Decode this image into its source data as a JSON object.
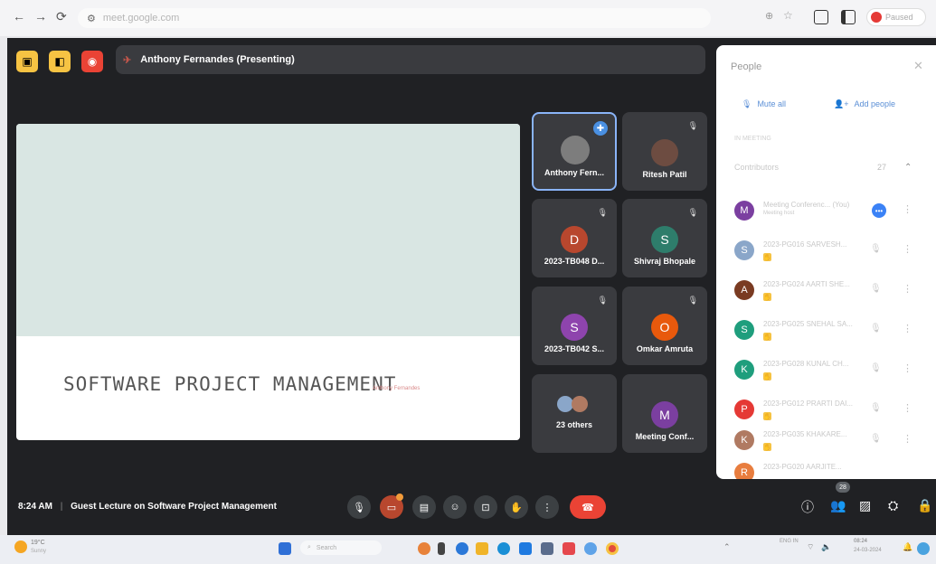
{
  "browser": {
    "url": "meet.google.com",
    "profile_label": "Paused"
  },
  "meet": {
    "presenter_label": "Anthony Fernandes (Presenting)",
    "slide": {
      "title": "SOFTWARE PROJECT MANAGEMENT",
      "subtitle": "Anthony Fernandes"
    },
    "tiles": [
      {
        "name": "Anthony Fern...",
        "initial": "",
        "color": "#5f6368"
      },
      {
        "name": "Ritesh Patil",
        "initial": "",
        "color": "#6d4c41"
      },
      {
        "name": "2023-TB048 D...",
        "initial": "D",
        "color": "#b8472e"
      },
      {
        "name": "Shivraj Bhopale",
        "initial": "S",
        "color": "#2e7d6b"
      },
      {
        "name": "2023-TB042 S...",
        "initial": "S",
        "color": "#8e44ad"
      },
      {
        "name": "Omkar Amruta",
        "initial": "O",
        "color": "#e8590c"
      },
      {
        "name": "23 others",
        "initial": "",
        "color": ""
      },
      {
        "name": "Meeting Conf...",
        "initial": "M",
        "color": "#7b3fa0"
      }
    ],
    "meeting_time": "8:24 AM",
    "meeting_title": "Guest Lecture on Software Project Management",
    "participant_count": "28"
  },
  "people": {
    "title": "People",
    "mute_all": "Mute all",
    "add_people": "Add people",
    "in_meeting": "IN MEETING",
    "contributors_label": "Contributors",
    "contributors_count": "27",
    "rows": [
      {
        "initial": "M",
        "color": "#7b3fa0",
        "name": "Meeting Conferenc... (You)",
        "sub": "Meeting host"
      },
      {
        "initial": "S",
        "color": "#8aa6c9",
        "name": "2023-PG016 SARVESH..."
      },
      {
        "initial": "A",
        "color": "#7a3b22",
        "name": "2023-PG024 AARTI SHE..."
      },
      {
        "initial": "S",
        "color": "#1f9e7d",
        "name": "2023-PG025 SNEHAL SA..."
      },
      {
        "initial": "K",
        "color": "#1f9e7d",
        "name": "2023-PG028 KUNAL CH..."
      },
      {
        "initial": "P",
        "color": "#e53935",
        "name": "2023-PG012 PRARTI DAI..."
      },
      {
        "initial": "K",
        "color": "#b07a62",
        "name": "2023-PG035 KHAKARE..."
      },
      {
        "initial": "R",
        "color": "#e87d3e",
        "name": "2023-PG020 AARJITE..."
      }
    ]
  },
  "taskbar": {
    "weather": "19°C",
    "weather_sub": "Sunny",
    "search": "Search",
    "lang": "ENG IN",
    "time": "08:24",
    "date": "24-03-2024"
  }
}
